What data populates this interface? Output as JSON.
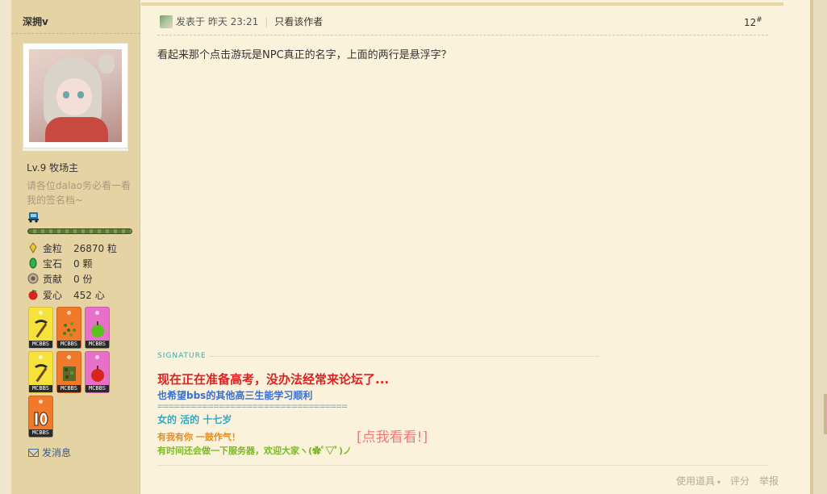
{
  "author": {
    "name": "深拥v",
    "level": "Lv.9 牧场主",
    "tagline": "请各位dalao务必看一看我的签名档~",
    "level_progress": 1.0,
    "stats": [
      {
        "icon": "gold-nugget-icon",
        "label": "金粒",
        "value": "26870 粒",
        "color": "#e8c540"
      },
      {
        "icon": "emerald-icon",
        "label": "宝石",
        "value": "0 颗",
        "color": "#2fb24a"
      },
      {
        "icon": "contribution-icon",
        "label": "贡献",
        "value": "0 份",
        "color": "#8a7a6a"
      },
      {
        "icon": "apple-heart-icon",
        "label": "爱心",
        "value": "452 心",
        "color": "#d8241c"
      }
    ],
    "medal_tag": "MCBBS",
    "medals": [
      {
        "name": "medal-pickaxe-yellow",
        "bg": "#f6e23a",
        "art": "pickaxe"
      },
      {
        "name": "medal-seeds-orange",
        "bg": "#f07a2a",
        "art": "seeds"
      },
      {
        "name": "medal-apple-pink",
        "bg": "#e870c8",
        "art": "green-apple"
      },
      {
        "name": "medal-pickaxe-yellow-2",
        "bg": "#f6e23a",
        "art": "pickaxe"
      },
      {
        "name": "medal-leaves-orange",
        "bg": "#f07a2a",
        "art": "leaves"
      },
      {
        "name": "medal-apple-pink-2",
        "bg": "#e870c8",
        "art": "red-apple"
      },
      {
        "name": "medal-ten-orange",
        "bg": "#f07a2a",
        "art": "ten"
      }
    ],
    "send_message": "发消息"
  },
  "post": {
    "posted_at": "发表于 昨天 23:21",
    "only_author": "只看该作者",
    "floor": "12",
    "floor_suffix": "#",
    "body": "看起来那个点击游玩是NPC真正的名字，上面的两行是悬浮字？"
  },
  "signature": {
    "label": "SIGNATURE",
    "line1": "现在正在准备高考，没办法经常来论坛了...",
    "line2": "也希望bbs的其他高三生能学习顺利",
    "line3": "==================================",
    "line4": "女的 活的 十七岁",
    "line5": "有我有你 一鼓作气！",
    "link": "[点我看看!]",
    "line6": "有时间还会做一下服务器，欢迎大家ヽ(✿ﾟ▽ﾟ)ノ"
  },
  "actions": {
    "use_item": "使用道具",
    "rate": "评分",
    "report": "举报"
  }
}
